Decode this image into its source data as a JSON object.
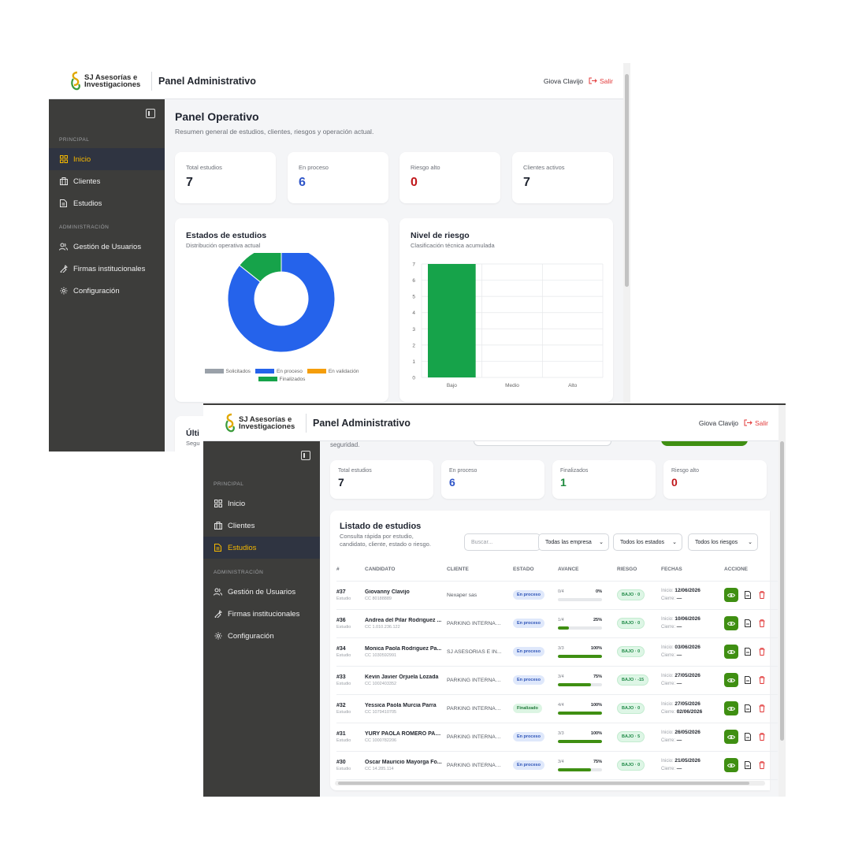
{
  "app": {
    "brand": [
      "SJ Asesorías e",
      "Investigaciones"
    ],
    "title": "Panel Administrativo",
    "user": "Giova Clavijo",
    "logout": "Salir"
  },
  "sidebar": {
    "sections": [
      {
        "title": "PRINCIPAL",
        "items": [
          {
            "label": "Inicio",
            "icon": "grid-icon"
          },
          {
            "label": "Clientes",
            "icon": "briefcase-icon"
          },
          {
            "label": "Estudios",
            "icon": "document-icon"
          }
        ]
      },
      {
        "title": "ADMINISTRACIÓN",
        "items": [
          {
            "label": "Gestión de Usuarios",
            "icon": "users-icon"
          },
          {
            "label": "Firmas institucionales",
            "icon": "signature-icon"
          },
          {
            "label": "Configuración",
            "icon": "gear-icon"
          }
        ]
      }
    ]
  },
  "dashboard": {
    "title": "Panel Operativo",
    "subtitle": "Resumen general de estudios, clientes, riesgos y operación actual.",
    "stats": [
      {
        "label": "Total estudios",
        "value": "7",
        "color": "#1f2430"
      },
      {
        "label": "En proceso",
        "value": "6",
        "color": "#2f55c8"
      },
      {
        "label": "Riesgo alto",
        "value": "0",
        "color": "#c0171b"
      },
      {
        "label": "Clientes activos",
        "value": "7",
        "color": "#1f2430"
      }
    ],
    "next_card_title": "Últi",
    "next_card_sub": "Segu"
  },
  "chart_data": [
    {
      "type": "pie",
      "title": "Estados de estudios",
      "subtitle": "Distribución operativa actual",
      "categories": [
        "Solicitados",
        "En proceso",
        "En validación",
        "Finalizados"
      ],
      "values": [
        0,
        6,
        0,
        1
      ],
      "colors": [
        "#9aa1a9",
        "#2563eb",
        "#f59e0b",
        "#16a34a"
      ],
      "legend": "bottom"
    },
    {
      "type": "bar",
      "title": "Nivel de riesgo",
      "subtitle": "Clasificación técnica acumulada",
      "categories": [
        "Bajo",
        "Medio",
        "Alto"
      ],
      "values": [
        7,
        0,
        0
      ],
      "ylim": [
        0,
        7
      ],
      "yticks": [
        "0",
        "1",
        "2",
        "3",
        "4",
        "5",
        "6",
        "7"
      ],
      "color": "#16a34a",
      "grid": true
    }
  ],
  "estudios": {
    "cut_text": "seguridad.",
    "stats": [
      {
        "label": "Total estudios",
        "value": "7",
        "color": "#1f2430"
      },
      {
        "label": "En proceso",
        "value": "6",
        "color": "#2f55c8"
      },
      {
        "label": "Finalizados",
        "value": "1",
        "color": "#1e8a3e"
      },
      {
        "label": "Riesgo alto",
        "value": "0",
        "color": "#c0171b"
      }
    ],
    "list_title": "Listado de estudios",
    "list_sub": [
      "Consulta rápida por estudio,",
      "candidato, cliente, estado o riesgo."
    ],
    "search_placeholder": "Buscar...",
    "filters": [
      "Todas las empresa",
      "Todos los estados",
      "Todos los riesgos"
    ],
    "columns": [
      "#",
      "CANDIDATO",
      "CLIENTE",
      "ESTADO",
      "AVANCE",
      "RIESGO",
      "FECHAS",
      "ACCIONE"
    ],
    "rows": [
      {
        "id": "#37",
        "sub": "Estudio",
        "name": "Giovanny Clavijo",
        "cc": "CC 80188889",
        "client": "Nexaper sas",
        "status": "En proceso",
        "progress": "0/4",
        "pct": "0%",
        "fill": 0,
        "risk": "BAJO · 0",
        "start_label": "Inicio:",
        "start": "12/06/2026",
        "end_label": "Cierre:",
        "end": "—"
      },
      {
        "id": "#36",
        "sub": "Estudio",
        "name": "Andrea del Pilar Rodriguez ...",
        "cc": "CC 1.010.236.122",
        "client": "PARKING INTERNACI...",
        "status": "En proceso",
        "progress": "1/4",
        "pct": "25%",
        "fill": 25,
        "risk": "BAJO · 0",
        "start_label": "Inicio:",
        "start": "10/06/2026",
        "end_label": "Cierre:",
        "end": "—"
      },
      {
        "id": "#34",
        "sub": "Estudio",
        "name": "Monica Paola Rodriguez Pa...",
        "cc": "CC 1030592991",
        "client": "SJ ASESORIAS E IN...",
        "status": "En proceso",
        "progress": "3/3",
        "pct": "100%",
        "fill": 100,
        "risk": "BAJO · 0",
        "start_label": "Inicio:",
        "start": "03/06/2026",
        "end_label": "Cierre:",
        "end": "—"
      },
      {
        "id": "#33",
        "sub": "Estudio",
        "name": "Kevin Javier Orjuela Lozada",
        "cc": "CC 1002403352",
        "client": "PARKING INTERNACI...",
        "status": "En proceso",
        "progress": "3/4",
        "pct": "75%",
        "fill": 75,
        "risk": "BAJO · -15",
        "start_label": "Inicio:",
        "start": "27/05/2026",
        "end_label": "Cierre:",
        "end": "—"
      },
      {
        "id": "#32",
        "sub": "Estudio",
        "name": "Yessica Paola Murcia Parra",
        "cc": "CC 1079410705",
        "client": "PARKING INTERNACI...",
        "status": "Finalizado",
        "progress": "4/4",
        "pct": "100%",
        "fill": 100,
        "risk": "BAJO · 0",
        "start_label": "Inicio:",
        "start": "27/05/2026",
        "end_label": "Cierre:",
        "end": "02/06/2026"
      },
      {
        "id": "#31",
        "sub": "Estudio",
        "name": "YURY PAOLA ROMERO PAR...",
        "cc": "CC 1000782206",
        "client": "PARKING INTERNACI...",
        "status": "En proceso",
        "progress": "3/3",
        "pct": "100%",
        "fill": 100,
        "risk": "BAJO · 5",
        "start_label": "Inicio:",
        "start": "26/05/2026",
        "end_label": "Cierre:",
        "end": "—"
      },
      {
        "id": "#30",
        "sub": "Estudio",
        "name": "Óscar Mauricio Mayorga Fo...",
        "cc": "CC 14.285.114",
        "client": "PARKING INTERNACI...",
        "status": "En proceso",
        "progress": "3/4",
        "pct": "75%",
        "fill": 75,
        "risk": "BAJO · 0",
        "start_label": "Inicio:",
        "start": "21/05/2026",
        "end_label": "Cierre:",
        "end": "—"
      }
    ]
  }
}
